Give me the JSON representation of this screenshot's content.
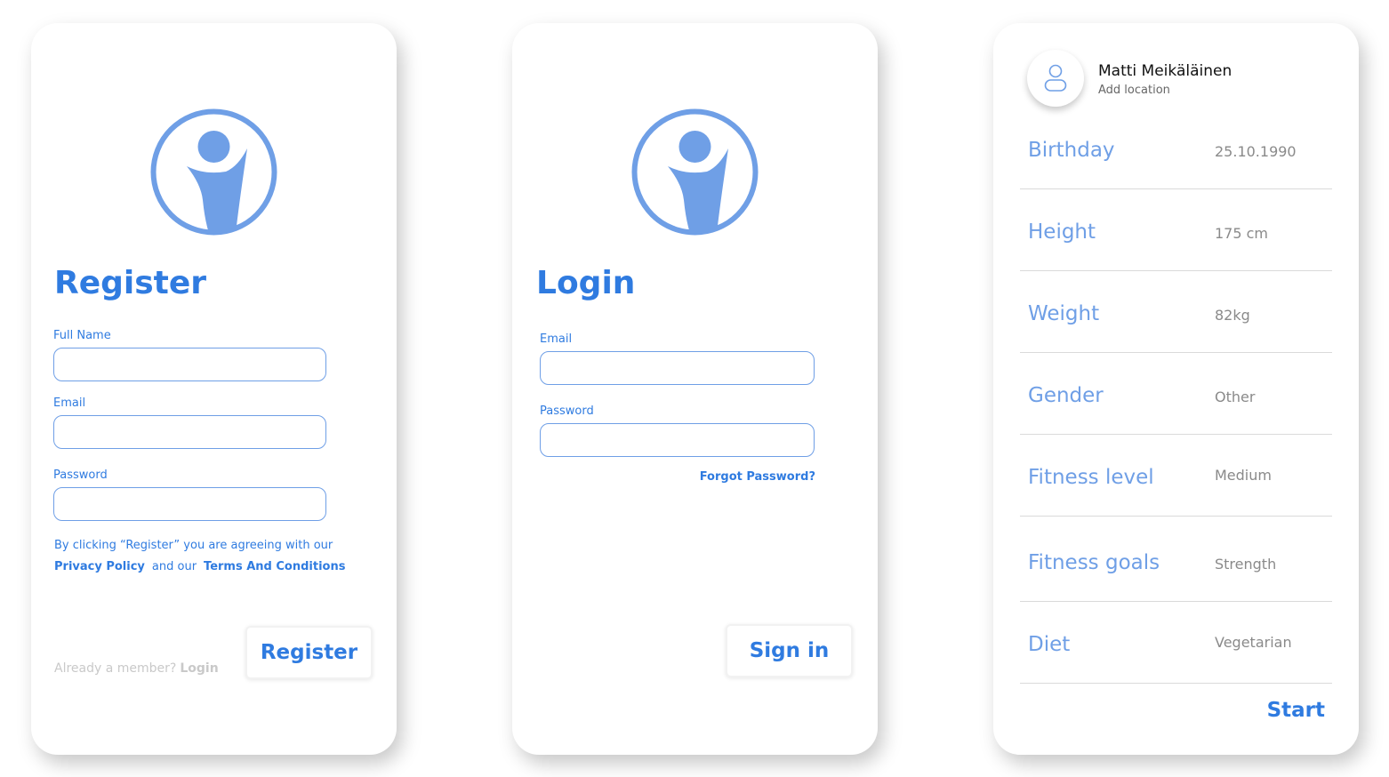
{
  "colors": {
    "brand_blue": "#2f7be0",
    "logo_blue": "#6f9fe6",
    "muted_grey": "#8a8a8a"
  },
  "register": {
    "title": "Register",
    "full_name_label": "Full Name",
    "email_label": "Email",
    "password_label": "Password",
    "terms_line1": "By clicking “Register” you are agreeing with our",
    "privacy_link": "Privacy Policy",
    "and_our": "and our",
    "terms_link": "Terms And Conditions",
    "already_member": "Already a member?",
    "login_link": "Login",
    "register_button": "Register",
    "logo_icon": "person-logo-icon"
  },
  "login": {
    "title": "Login",
    "email_label": "Email",
    "password_label": "Password",
    "forgot_password": "Forgot Password?",
    "sign_in_button": "Sign in",
    "logo_icon": "person-logo-icon"
  },
  "profile": {
    "avatar_icon": "user-icon",
    "name": "Matti Meikäläinen",
    "add_location": "Add location",
    "rows": [
      {
        "label": "Birthday",
        "value": "25.10.1990"
      },
      {
        "label": "Height",
        "value": "175 cm"
      },
      {
        "label": "Weight",
        "value": "82kg"
      },
      {
        "label": "Gender",
        "value": "Other"
      },
      {
        "label": "Fitness level",
        "value": "Medium"
      },
      {
        "label": "Fitness goals",
        "value": "Strength"
      },
      {
        "label": "Diet",
        "value": "Vegetarian"
      }
    ],
    "start_button": "Start"
  }
}
